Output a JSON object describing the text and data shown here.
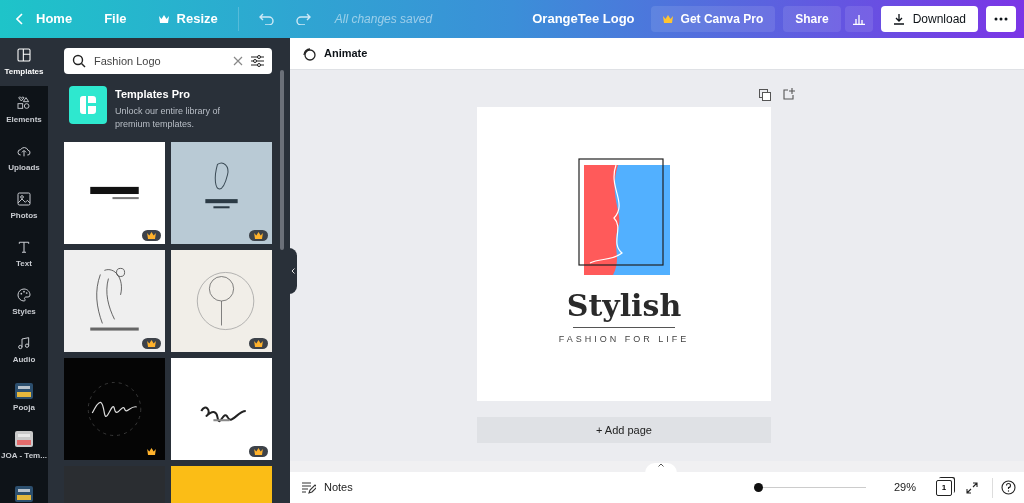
{
  "topbar": {
    "home": "Home",
    "file": "File",
    "resize": "Resize",
    "saved": "All changes saved",
    "title": "OrangeTee Logo",
    "pro_button": "Get Canva Pro",
    "share": "Share",
    "download": "Download"
  },
  "rail": [
    {
      "label": "Templates",
      "kind": "templates",
      "selected": true
    },
    {
      "label": "Elements",
      "kind": "elements",
      "selected": false
    },
    {
      "label": "Uploads",
      "kind": "uploads",
      "selected": false
    },
    {
      "label": "Photos",
      "kind": "photos",
      "selected": false
    },
    {
      "label": "Text",
      "kind": "text",
      "selected": false
    },
    {
      "label": "Styles",
      "kind": "styles",
      "selected": false
    },
    {
      "label": "Audio",
      "kind": "audio",
      "selected": false
    },
    {
      "label": "Pooja",
      "kind": "thumb",
      "selected": false
    },
    {
      "label": "JOA - Tem...",
      "kind": "thumb",
      "selected": false
    },
    {
      "kind": "thumb",
      "selected": false
    }
  ],
  "panel": {
    "search": {
      "value": "Fashion Logo"
    },
    "promo": {
      "title": "Templates Pro",
      "text": "Unlock our entire library of premium templates."
    },
    "templates": [
      {
        "kind": "picture",
        "pro": true
      },
      {
        "kind": "picture",
        "pro": true
      },
      {
        "kind": "picture",
        "pro": true
      },
      {
        "kind": "picture",
        "pro": true
      },
      {
        "kind": "picture",
        "pro": true
      },
      {
        "kind": "picture",
        "pro": true
      },
      {
        "kind": "picture"
      },
      {
        "kind": "picture"
      }
    ]
  },
  "toolbar": {
    "animate": "Animate"
  },
  "design": {
    "title": "Stylish",
    "tagline": "FASHION FOR LIFE"
  },
  "add_page": "+ Add page",
  "footer": {
    "notes": "Notes",
    "zoom": {
      "level": 0.0,
      "reading": "29%"
    },
    "page_count": "1"
  }
}
